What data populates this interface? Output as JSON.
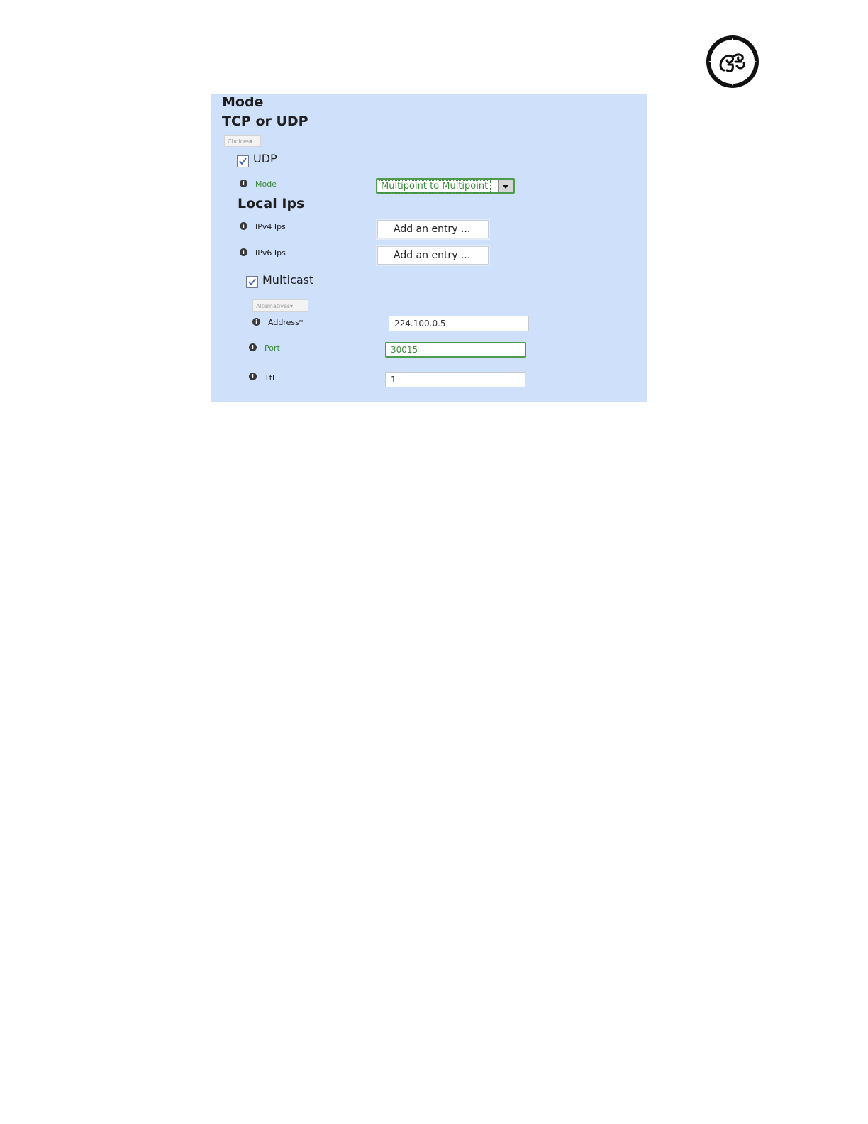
{
  "brand": {
    "logo_icon": "ge-monogram-logo",
    "logo_text": "GE"
  },
  "screenshot": {
    "background": "#cfe0fa",
    "section_title": "Mode",
    "subsection_title": "TCP or UDP",
    "choices_dropdown": "Choices▾",
    "udp": {
      "checked": true,
      "label": "UDP"
    },
    "mode_field": {
      "label": "Mode",
      "selected": "Multipoint to Multipoint",
      "arrow_icon": "dropdown-arrow-icon"
    },
    "local_ips": {
      "title": "Local Ips",
      "ipv4": {
        "label": "IPv4 Ips",
        "button": "Add an entry ..."
      },
      "ipv6": {
        "label": "IPv6 Ips",
        "button": "Add an entry ..."
      }
    },
    "multicast": {
      "checked": true,
      "label": "Multicast",
      "alternatives_dropdown": "Alternatives▾",
      "address": {
        "label": "Address*",
        "value": "224.100.0.5"
      },
      "port": {
        "label": "Port",
        "value": "30015"
      },
      "ttl": {
        "label": "Ttl",
        "value": "1"
      }
    },
    "info_icon": "info-icon",
    "info_glyph": "i",
    "accent_green": "#3b8a3b"
  }
}
